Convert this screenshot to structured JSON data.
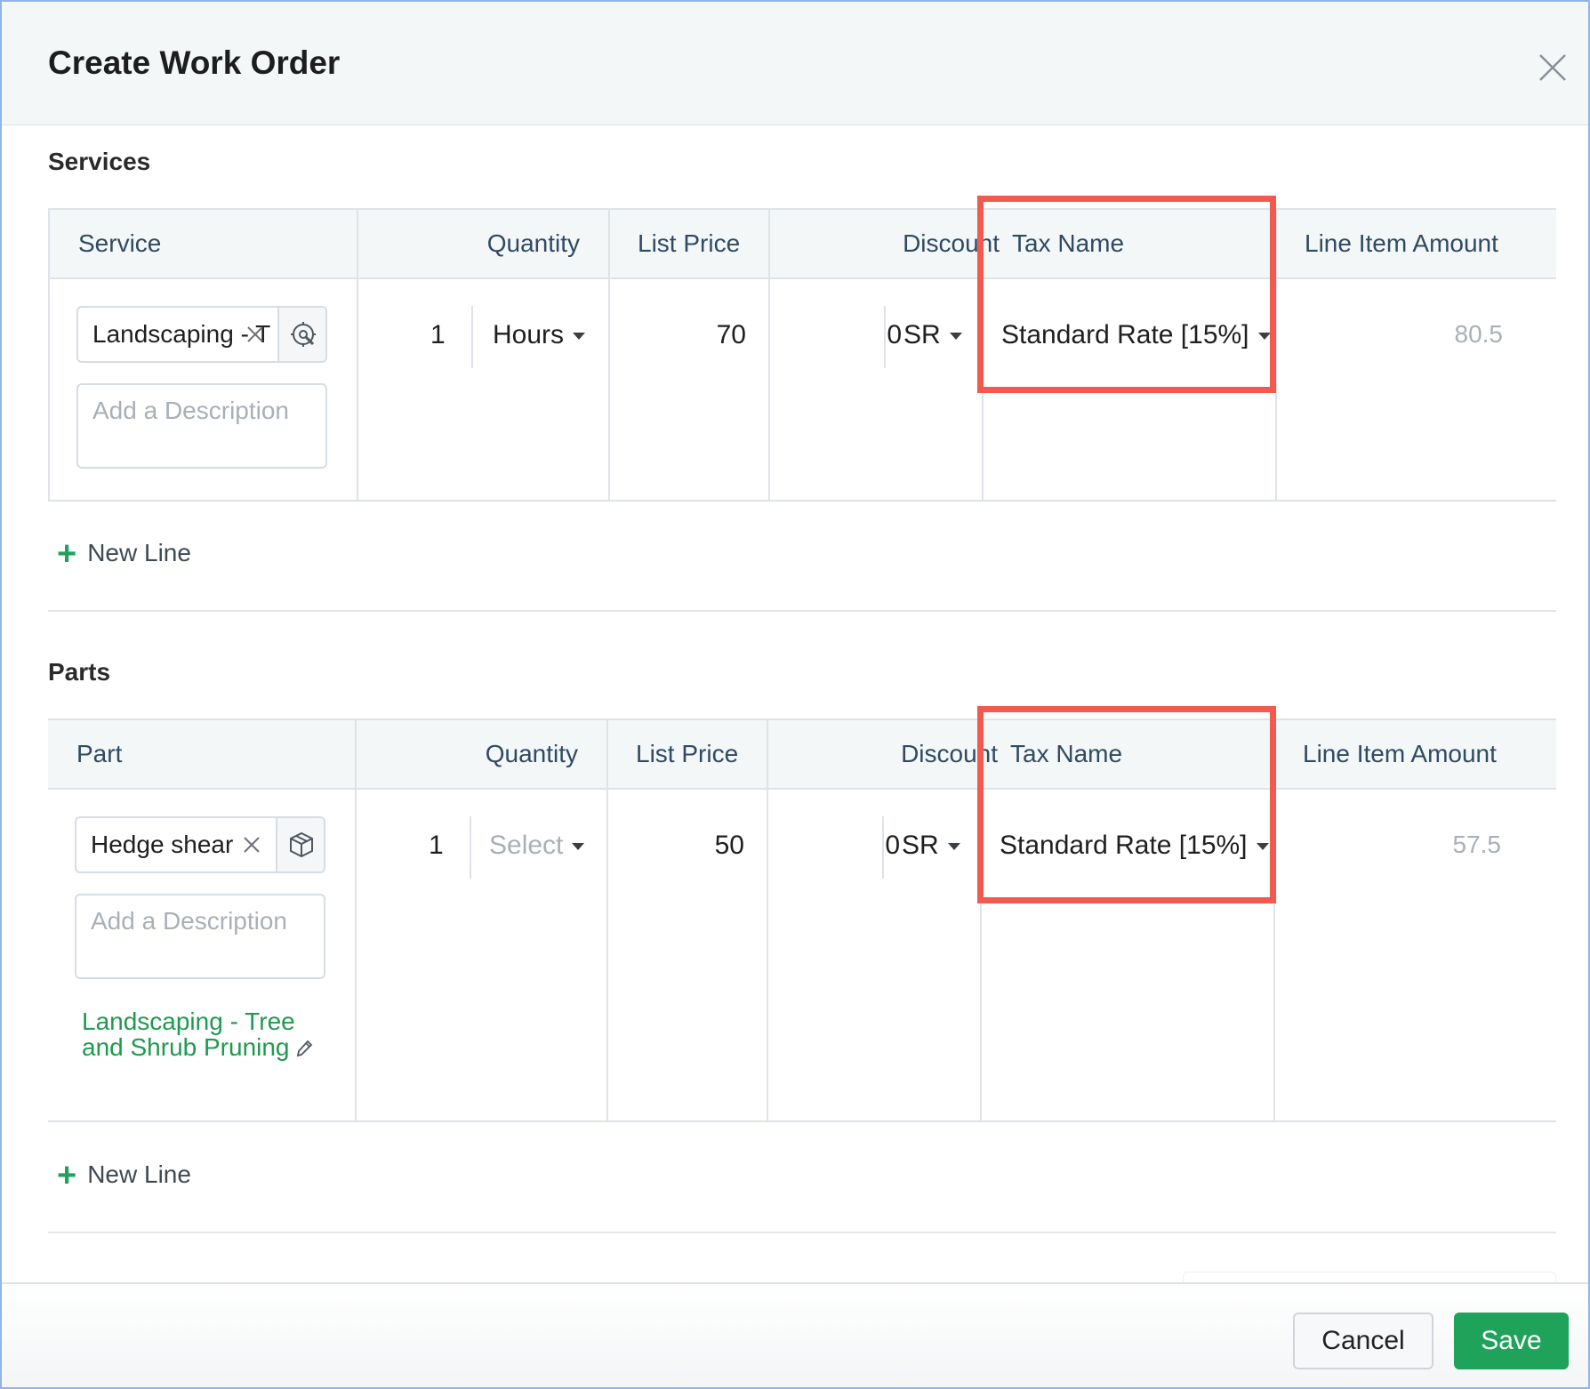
{
  "modal": {
    "title": "Create Work Order"
  },
  "services": {
    "section_title": "Services",
    "columns": {
      "item": "Service",
      "quantity": "Quantity",
      "list_price": "List Price",
      "discount": "Discount",
      "tax_name": "Tax Name",
      "line_item_amount": "Line Item Amount"
    },
    "row": {
      "item_value": "Landscaping - T",
      "description_placeholder": "Add a Description",
      "quantity": "1",
      "unit": "Hours",
      "list_price": "70",
      "discount": "0",
      "discount_type": "SR",
      "tax": "Standard Rate [15%]",
      "amount": "80.5"
    },
    "new_line_label": "New Line"
  },
  "parts": {
    "section_title": "Parts",
    "columns": {
      "item": "Part",
      "quantity": "Quantity",
      "list_price": "List Price",
      "discount": "Discount",
      "tax_name": "Tax Name",
      "line_item_amount": "Line Item Amount"
    },
    "row": {
      "item_value": "Hedge shear",
      "description_placeholder": "Add a Description",
      "quantity": "1",
      "unit": "Select",
      "list_price": "50",
      "discount": "0",
      "discount_type": "SR",
      "tax": "Standard Rate [15%]",
      "amount": "57.5",
      "linked_service": "Landscaping - Tree and Shrub Pruning"
    },
    "new_line_label": "New Line"
  },
  "footer": {
    "cancel_label": "Cancel",
    "save_label": "Save"
  },
  "colors": {
    "accent_green": "#1fa35a",
    "highlight_red": "#f25a4f",
    "header_bg": "#f4f7f7"
  },
  "icons": {
    "close": "close-icon",
    "service_tool": "wrench-gear-icon",
    "part_tool": "box-icon",
    "clear": "clear-icon",
    "edit": "pencil-icon",
    "add": "plus-icon",
    "dropdown": "caret-down-icon"
  }
}
